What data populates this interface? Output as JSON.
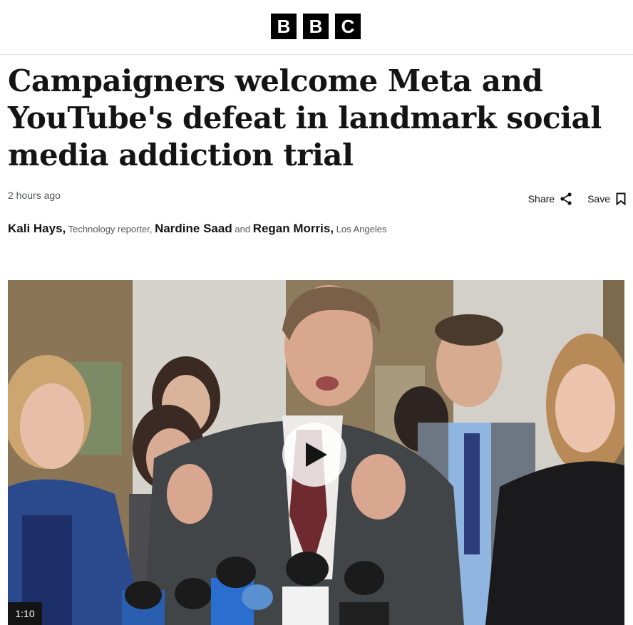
{
  "header": {
    "logo_letters": [
      "B",
      "B",
      "C"
    ]
  },
  "article": {
    "title": "Campaigners welcome Meta and YouTube's defeat in landmark social media addiction trial",
    "timestamp": "2 hours ago",
    "actions": {
      "share_label": "Share",
      "save_label": "Save"
    },
    "byline": {
      "author1_name": "Kali Hays,",
      "author1_role": "Technology reporter,",
      "author2_name": "Nardine Saad",
      "conjunction": "and",
      "author3_name": "Regan Morris,",
      "location": "Los Angeles"
    }
  },
  "media": {
    "duration": "1:10",
    "icons": {
      "play": "play-icon",
      "share": "share-icon",
      "save": "bookmark-icon"
    }
  },
  "colors": {
    "brand": "#000000",
    "text": "#141414",
    "muted": "#545658"
  }
}
